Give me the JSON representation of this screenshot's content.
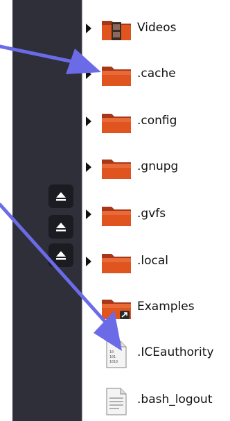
{
  "sidebar": {
    "eject_icons": [
      "eject-icon",
      "eject-icon",
      "eject-icon"
    ]
  },
  "files": [
    {
      "name": "Videos",
      "icon": "videos-folder-icon",
      "expandable": true
    },
    {
      "name": ".cache",
      "icon": "folder-icon",
      "expandable": true
    },
    {
      "name": ".config",
      "icon": "folder-icon",
      "expandable": true
    },
    {
      "name": ".gnupg",
      "icon": "folder-icon",
      "expandable": true
    },
    {
      "name": ".gvfs",
      "icon": "folder-icon",
      "expandable": true
    },
    {
      "name": ".local",
      "icon": "folder-icon",
      "expandable": true
    },
    {
      "name": "Examples",
      "icon": "folder-link-icon",
      "expandable": false
    },
    {
      "name": ".ICEauthority",
      "icon": "binary-file-icon",
      "expandable": false
    },
    {
      "name": ".bash_logout",
      "icon": "text-file-icon",
      "expandable": false
    }
  ],
  "annotation": {
    "arrow_color": "#6b6be8"
  }
}
